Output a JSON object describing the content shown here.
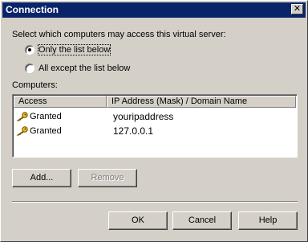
{
  "window": {
    "title": "Connection",
    "close_label": "✕"
  },
  "prompt": "Select which computers may access this virtual server:",
  "options": [
    {
      "label": "Only the list below",
      "selected": true
    },
    {
      "label": "All except the list below",
      "selected": false
    }
  ],
  "computers_label": "Computers:",
  "list": {
    "columns": [
      "Access",
      "IP Address (Mask) / Domain Name"
    ],
    "rows": [
      {
        "access": "Granted",
        "address": "youripaddress",
        "icon": "key-icon"
      },
      {
        "access": "Granted",
        "address": "127.0.0.1",
        "icon": "key-icon"
      }
    ]
  },
  "buttons": {
    "add": "Add...",
    "remove": "Remove",
    "ok": "OK",
    "cancel": "Cancel",
    "help": "Help"
  },
  "colors": {
    "titlebar": "#0a246a",
    "face": "#d4d0c8",
    "disabled_text": "#808080"
  }
}
